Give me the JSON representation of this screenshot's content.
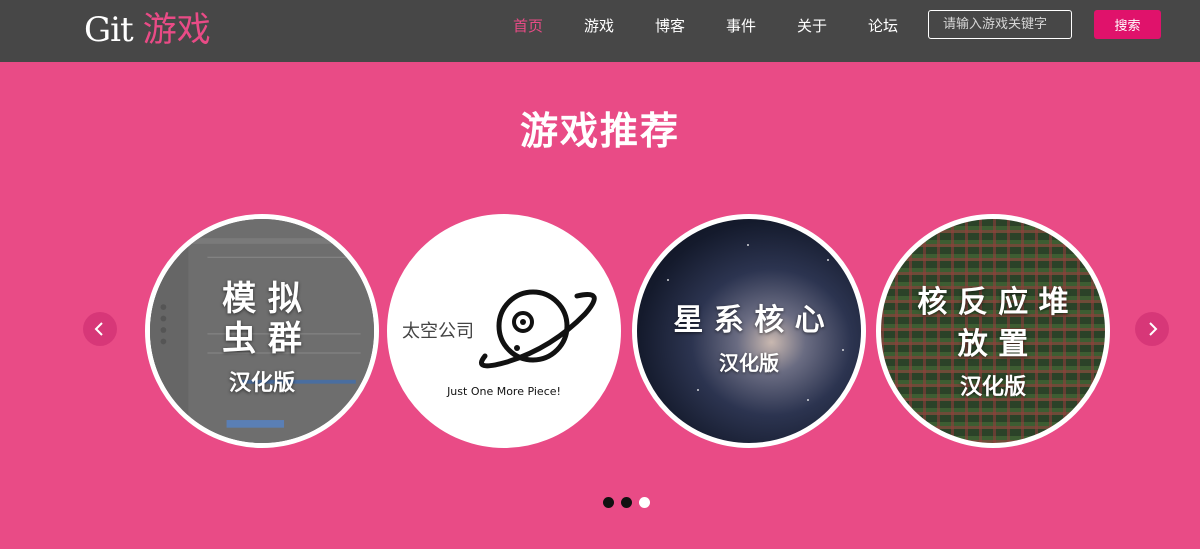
{
  "header": {
    "logo_git": "Git",
    "logo_game": "游戏",
    "nav": [
      {
        "label": "首页",
        "active": true
      },
      {
        "label": "游戏",
        "active": false
      },
      {
        "label": "博客",
        "active": false
      },
      {
        "label": "事件",
        "active": false
      },
      {
        "label": "关于",
        "active": false
      },
      {
        "label": "论坛",
        "active": false
      }
    ],
    "search_placeholder": "请输入游戏关键字",
    "search_value": "",
    "search_button": "搜索"
  },
  "main": {
    "title": "游戏推荐",
    "prev_icon": "chevron-left-icon",
    "next_icon": "chevron-right-icon",
    "games": [
      {
        "line1": "模 拟",
        "line2": "虫 群",
        "subtitle": "汉化版"
      },
      {
        "title": "太空公司",
        "tagline": "Just One More Piece!",
        "icon": "planet-icon"
      },
      {
        "line1": "星 系 核 心",
        "subtitle": "汉化版"
      },
      {
        "line1": "核 反 应 堆",
        "line2": "放 置",
        "subtitle": "汉化版"
      }
    ],
    "carousel": {
      "page_count": 3,
      "active_page": 3
    }
  },
  "colors": {
    "background": "#e94b86",
    "navbar": "#474747",
    "accent": "#e94b86",
    "button": "#e0126b"
  }
}
